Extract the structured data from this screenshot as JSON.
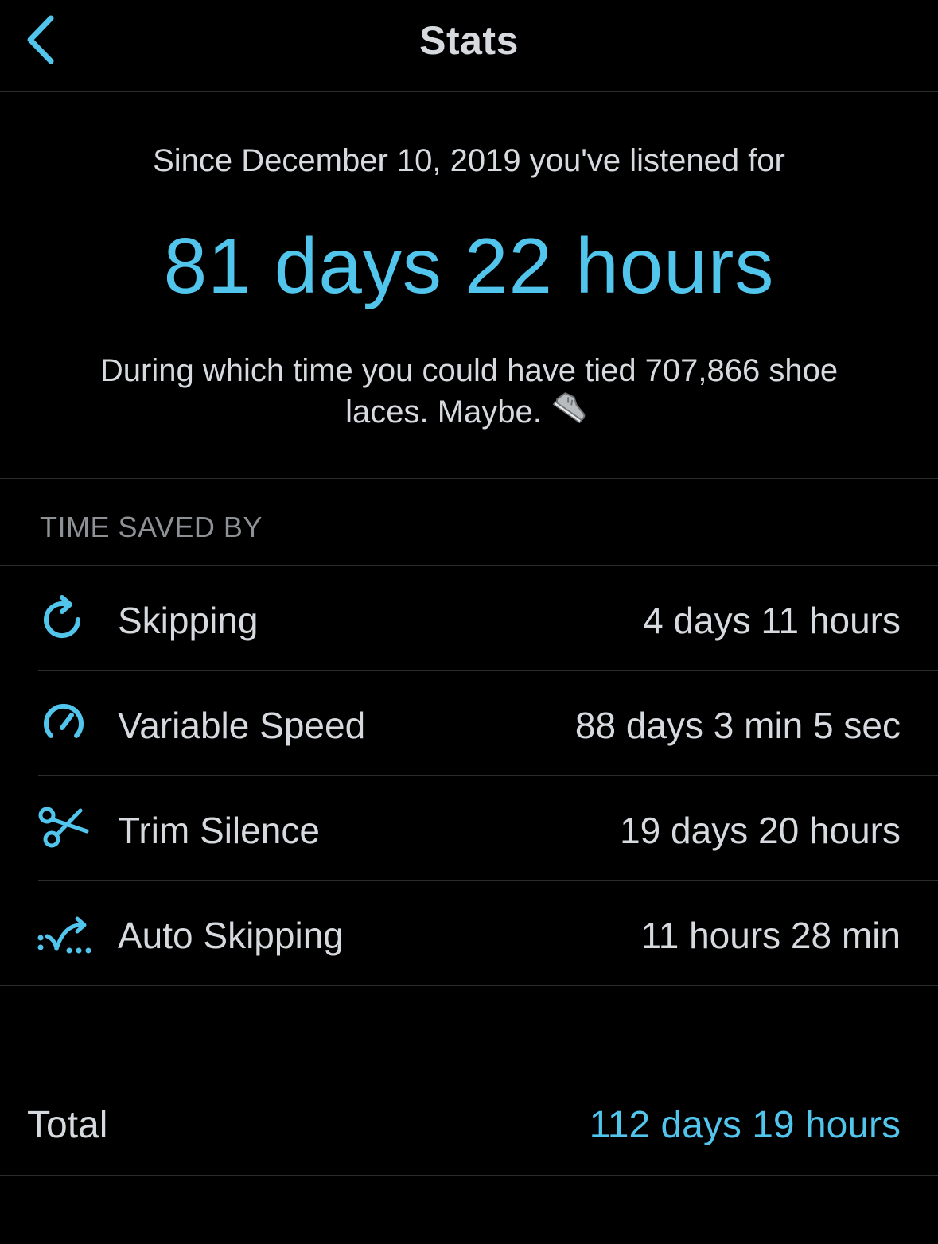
{
  "nav": {
    "title": "Stats",
    "back_icon": "chevron-left-icon"
  },
  "hero": {
    "since_text": "Since December 10, 2019 you've listened for",
    "listened_time": "81 days 22 hours",
    "fun_fact": "During which time you could have tied 707,866 shoe laces. Maybe.",
    "fun_fact_icon": "sneaker-icon"
  },
  "time_saved": {
    "header": "TIME SAVED BY",
    "rows": [
      {
        "icon": "skip-refresh-icon",
        "label": "Skipping",
        "value": "4 days 11 hours"
      },
      {
        "icon": "speedometer-icon",
        "label": "Variable Speed",
        "value": "88 days 3 min 5 sec"
      },
      {
        "icon": "scissors-icon",
        "label": "Trim Silence",
        "value": "19 days 20 hours"
      },
      {
        "icon": "auto-skip-icon",
        "label": "Auto Skipping",
        "value": "11 hours 28 min"
      }
    ]
  },
  "total": {
    "label": "Total",
    "value": "112 days 19 hours"
  },
  "colors": {
    "background": "#000000",
    "accent": "#52c5ec",
    "text_primary": "#d6dadf",
    "text_secondary": "#8e9297",
    "separator": "#2a2c2e"
  }
}
